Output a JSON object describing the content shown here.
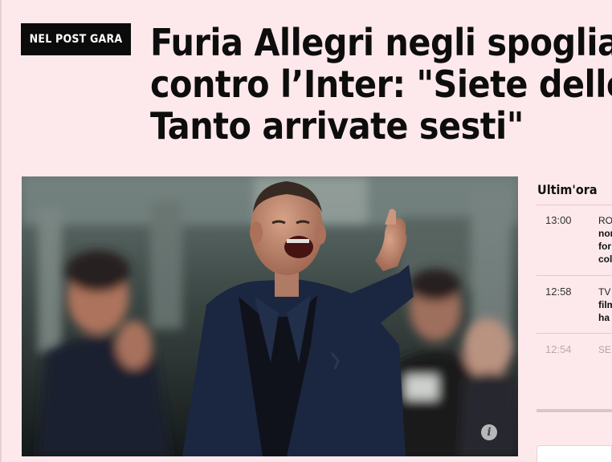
{
  "badge": {
    "label": "NEL POST GARA"
  },
  "headline": {
    "lines": [
      "Furia Allegri negli spogliatoi",
      "contro l’Inter: \"Siete delle m",
      "Tanto arrivate sesti\""
    ]
  },
  "photo": {
    "info_icon": "info-icon",
    "info_glyph": "i"
  },
  "sidebar": {
    "title": "Ultim'ora",
    "items": [
      {
        "time": "13:00",
        "kicker": "RO",
        "lines": [
          "nor",
          "for",
          "col"
        ]
      },
      {
        "time": "12:58",
        "kicker": "TV",
        "lines": [
          "film",
          "ha"
        ]
      },
      {
        "time": "12:54",
        "kicker": "SE",
        "lines": []
      }
    ]
  }
}
